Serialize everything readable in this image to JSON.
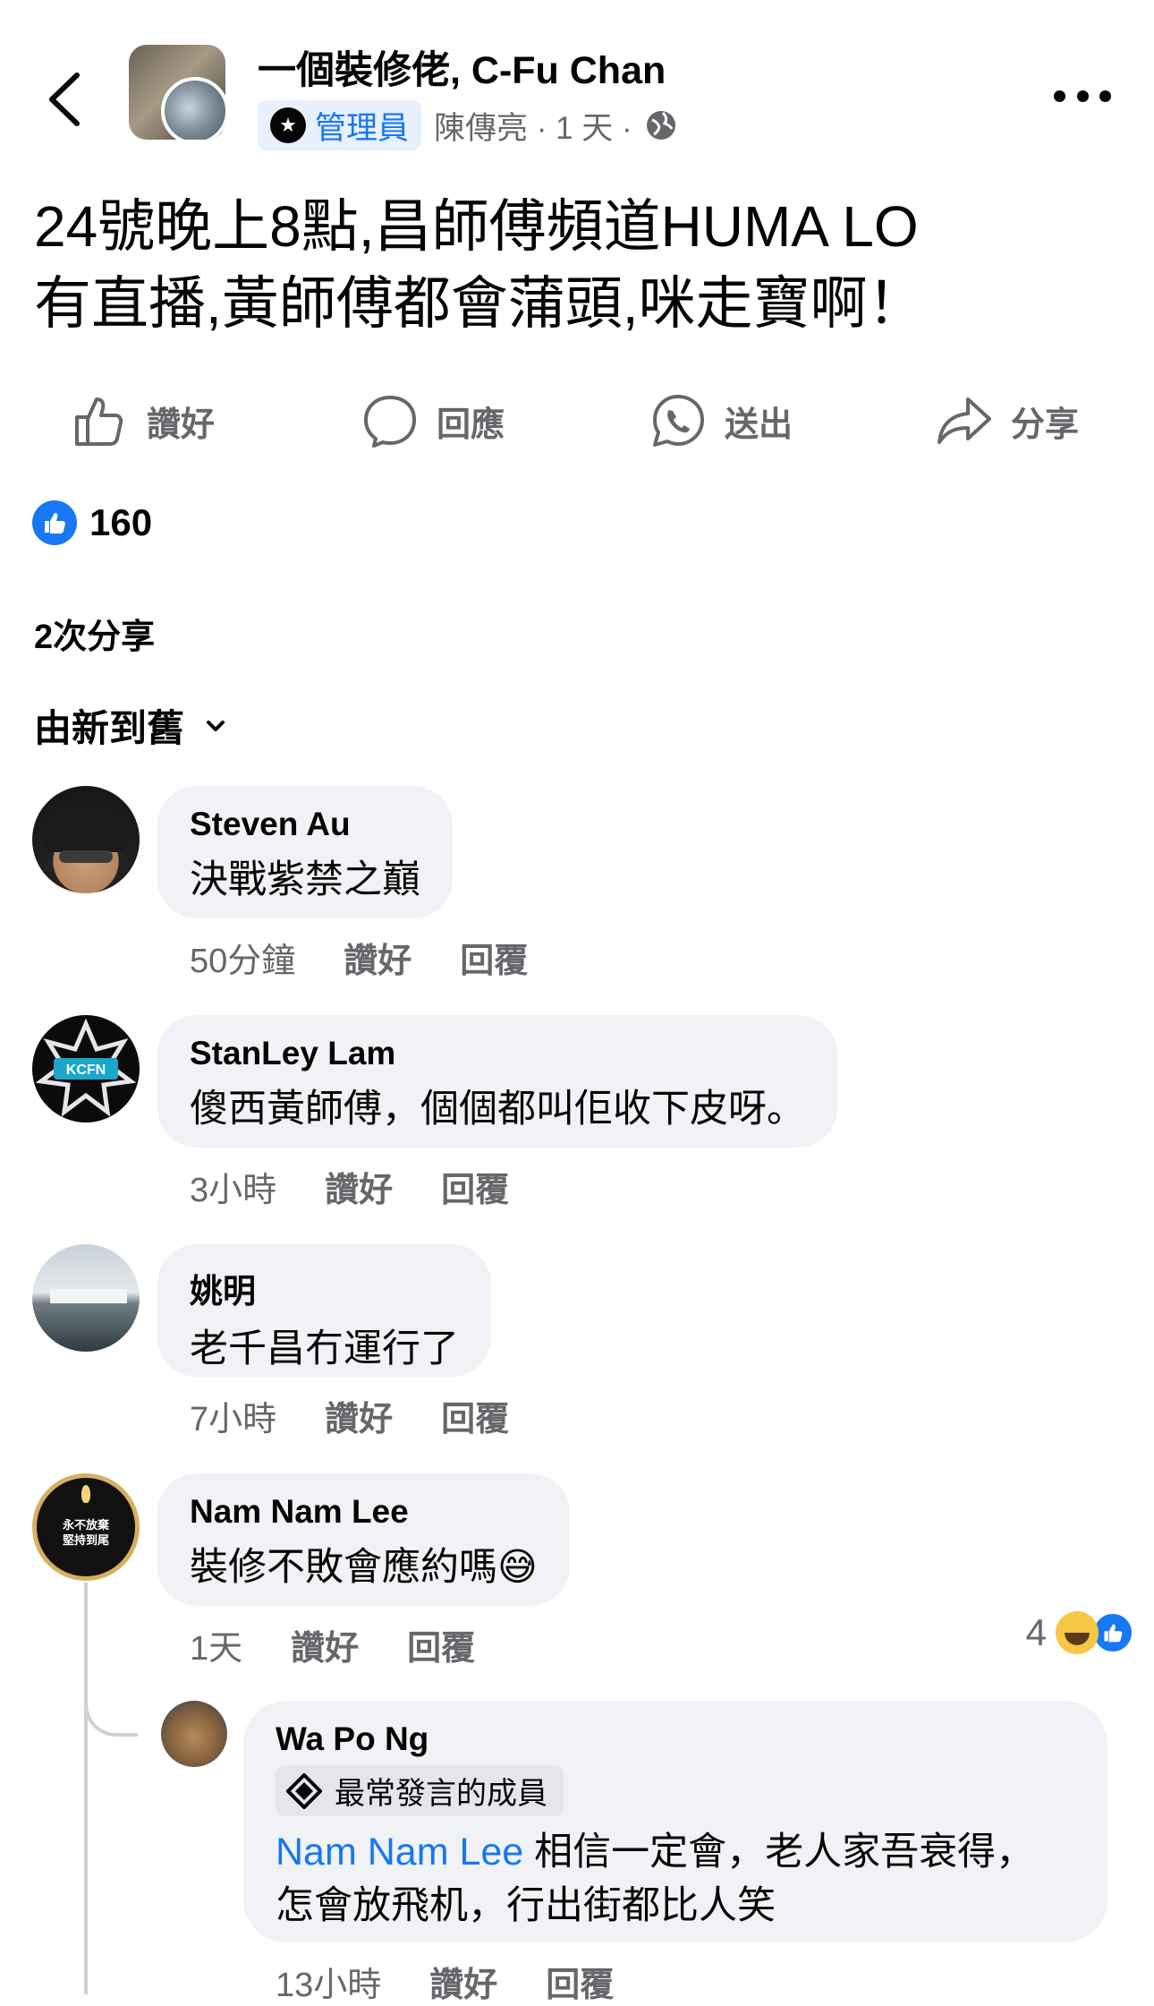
{
  "header": {
    "group_name": "一個裝修佬, C-Fu Chan",
    "admin_label": "管理員",
    "author_line": "陳傳亮 · 1 天 ·"
  },
  "post": {
    "line1": "24號晚上8點,昌師傅頻道HUMA LO",
    "line2": "有直播,黃師傅都會蒲頭,咪走寶啊！"
  },
  "actions": {
    "like": "讚好",
    "comment": "回應",
    "send": "送出",
    "share": "分享"
  },
  "reactions": {
    "count": "160"
  },
  "shares": "2次分享",
  "sort_label": "由新到舊",
  "comments": [
    {
      "name": "Steven Au",
      "text": "決戰紫禁之巔",
      "time": "50分鐘",
      "like": "讚好",
      "reply": "回覆"
    },
    {
      "name": "StanLey Lam",
      "text": "傻西黃師傅，個個都叫佢收下皮呀。",
      "time": "3小時",
      "like": "讚好",
      "reply": "回覆",
      "avatar_text": "KCFN"
    },
    {
      "name": "姚明",
      "text": "老千昌冇運行了",
      "time": "7小時",
      "like": "讚好",
      "reply": "回覆"
    },
    {
      "name": "Nam Nam Lee",
      "text": "裝修不敗會應約嗎",
      "emoji": "😅",
      "time": "1天",
      "like": "讚好",
      "reply": "回覆",
      "reaction_count": "4",
      "avatar_text_1": "永不放棄",
      "avatar_text_2": "堅持到尾"
    }
  ],
  "reply": {
    "name": "Wa Po Ng",
    "badge": "最常發言的成員",
    "mention": "Nam Nam Lee",
    "text_1": " 相信一定會，老人家吾衰得，",
    "text_2": "怎會放飛机，行出街都比人笑",
    "time": "13小時",
    "like": "讚好",
    "reply": "回覆"
  },
  "colors": {
    "accent": "#1877f2",
    "bubble": "#f0f2f5",
    "muted": "#65676b"
  }
}
